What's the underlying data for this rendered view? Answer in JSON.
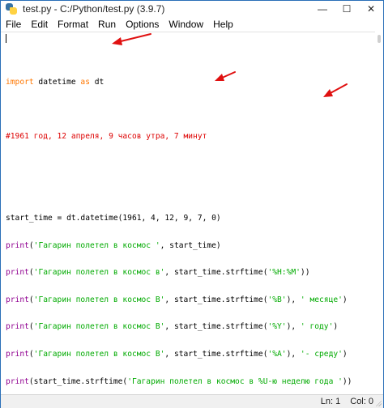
{
  "window": {
    "title": "test.py - C:/Python/test.py (3.9.7)",
    "min_label": "—",
    "max_label": "☐",
    "close_label": "✕"
  },
  "menu": [
    "File",
    "Edit",
    "Format",
    "Run",
    "Options",
    "Window",
    "Help"
  ],
  "code": {
    "line_import": {
      "kw1": "import",
      "mid": " datetime ",
      "kw2": "as",
      "end": " dt"
    },
    "comment": "#1961 год, 12 апреля, 9 часов утра, 7 минут",
    "assign": "start_time = dt.datetime(1961, 4, 12, 9, 7, 0)",
    "print_lines": [
      {
        "fn": "print",
        "open": "(",
        "s1": "'Гагарин полетел в космос '",
        "mid": ", start_time)",
        "s2": "",
        "tail": ""
      },
      {
        "fn": "print",
        "open": "(",
        "s1": "'Гагарин полетел в космос в'",
        "mid": ", start_time.strftime(",
        "s2": "'%H:%M'",
        "tail": "))"
      },
      {
        "fn": "print",
        "open": "(",
        "s1": "'Гагарин полетел в космос В'",
        "mid": ", start_time.strftime(",
        "s2": "'%B'",
        "tail": "), ",
        "s3": "' месяце'",
        "end": ")"
      },
      {
        "fn": "print",
        "open": "(",
        "s1": "'Гагарин полетел в космос В'",
        "mid": ", start_time.strftime(",
        "s2": "'%Y'",
        "tail": "), ",
        "s3": "' году'",
        "end": ")"
      },
      {
        "fn": "print",
        "open": "(",
        "s1": "'Гагарин полетел в космос В'",
        "mid": ", start_time.strftime(",
        "s2": "'%A'",
        "tail": "), ",
        "s3": "'- среду'",
        "end": ")"
      },
      {
        "fn": "print",
        "open": "(",
        "s1": "",
        "mid": "start_time.strftime(",
        "s2": "'Гагарин полетел в космос в %U-ю неделю года '",
        "tail": "))"
      }
    ]
  },
  "status": {
    "line": "Ln: 1",
    "col": "Col: 0"
  },
  "colors": {
    "keyword": "#ff7700",
    "builtin": "#900090",
    "string": "#00aa00",
    "comment": "#dd0000",
    "annotation_arrow": "#e01010"
  }
}
